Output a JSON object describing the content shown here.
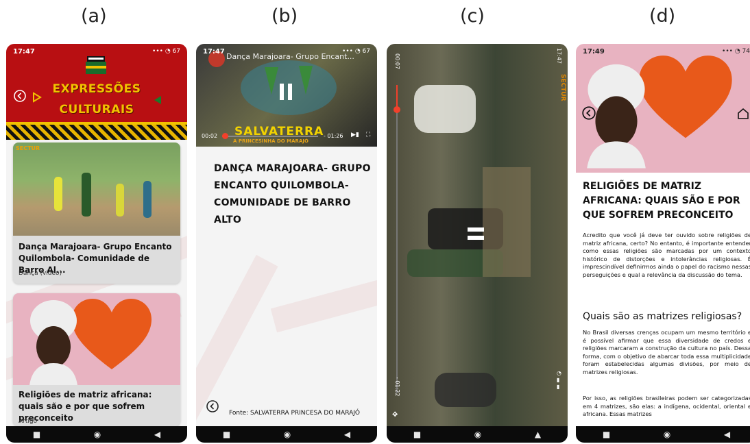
{
  "labels": [
    "(a)",
    "(b)",
    "(c)",
    "(d)"
  ],
  "phone_a": {
    "status_time": "17:47",
    "status_icons": "••• ◔ 67",
    "title_line1": "EXPRESSÕES",
    "title_line2": "CULTURAIS",
    "card1_badge": "SECTUR",
    "card1_title": "Dança Marajoara- Grupo Encanto Quilombola- Comunidade de Barro Al...",
    "card1_subtitle": "Dança (vídeo)",
    "card2_title": "Religiões de matriz africana: quais são e por que sofrem preconceito",
    "card2_subtitle": "Artigo"
  },
  "phone_b": {
    "status_time": "17:47",
    "status_icons": "••• ◔ 67",
    "video_title": "Dança Marajoara- Grupo Encant...",
    "poster_text1": "SALVATERRA",
    "poster_text2": "A PRINCESINHA DO MARAJÓ",
    "elapsed": "00:02",
    "remaining": "- 01:26",
    "title": "DANÇA MARAJOARA- GRUPO ENCANTO QUILOMBOLA- COMUNIDADE DE BARRO ALTO",
    "source": "Fonte: SALVATERRA PRINCESA DO MARAJÓ",
    "progress": 0.03
  },
  "phone_c": {
    "elapsed": "00:07",
    "remaining": "- 01:22",
    "status_time": "17:47",
    "badge": "SECTUR",
    "progress": 0.08
  },
  "phone_d": {
    "status_time": "17:49",
    "status_icons": "••• ◔ 74",
    "heading": "RELIGIÕES DE MATRIZ AFRICANA: QUAIS SÃO E POR QUE SOFREM PRECONCEITO",
    "para1": "Acredito que você já deve ter ouvido sobre religiões de matriz africana, certo? No entanto, é importante entender como essas religiões são marcadas por um contexto histórico de distorções e intolerâncias religiosas. É imprescindível definirmos ainda o papel do racismo nessas perseguições e qual a relevância da discussão do tema.",
    "subheading": "Quais são as matrizes religiosas?",
    "para2": "No Brasil diversas crenças ocupam um mesmo território e é possível afirmar que essa diversidade de credos e religiões marcaram a construção da cultura no país. Dessa forma, com o objetivo de abarcar toda essa multiplicidade foram estabelecidas algumas divisões, por meio de matrizes religiosas.",
    "para3": "Por isso, as religiões brasileiras podem ser categorizadas em 4 matrizes, são elas: a indígena, ocidental, oriental e africana. Essas matrizes"
  },
  "colors": {
    "header_red": "#b80f12",
    "gold": "#f2c200",
    "heart_orange": "#e8591a",
    "pink": "#e8b3c1"
  }
}
